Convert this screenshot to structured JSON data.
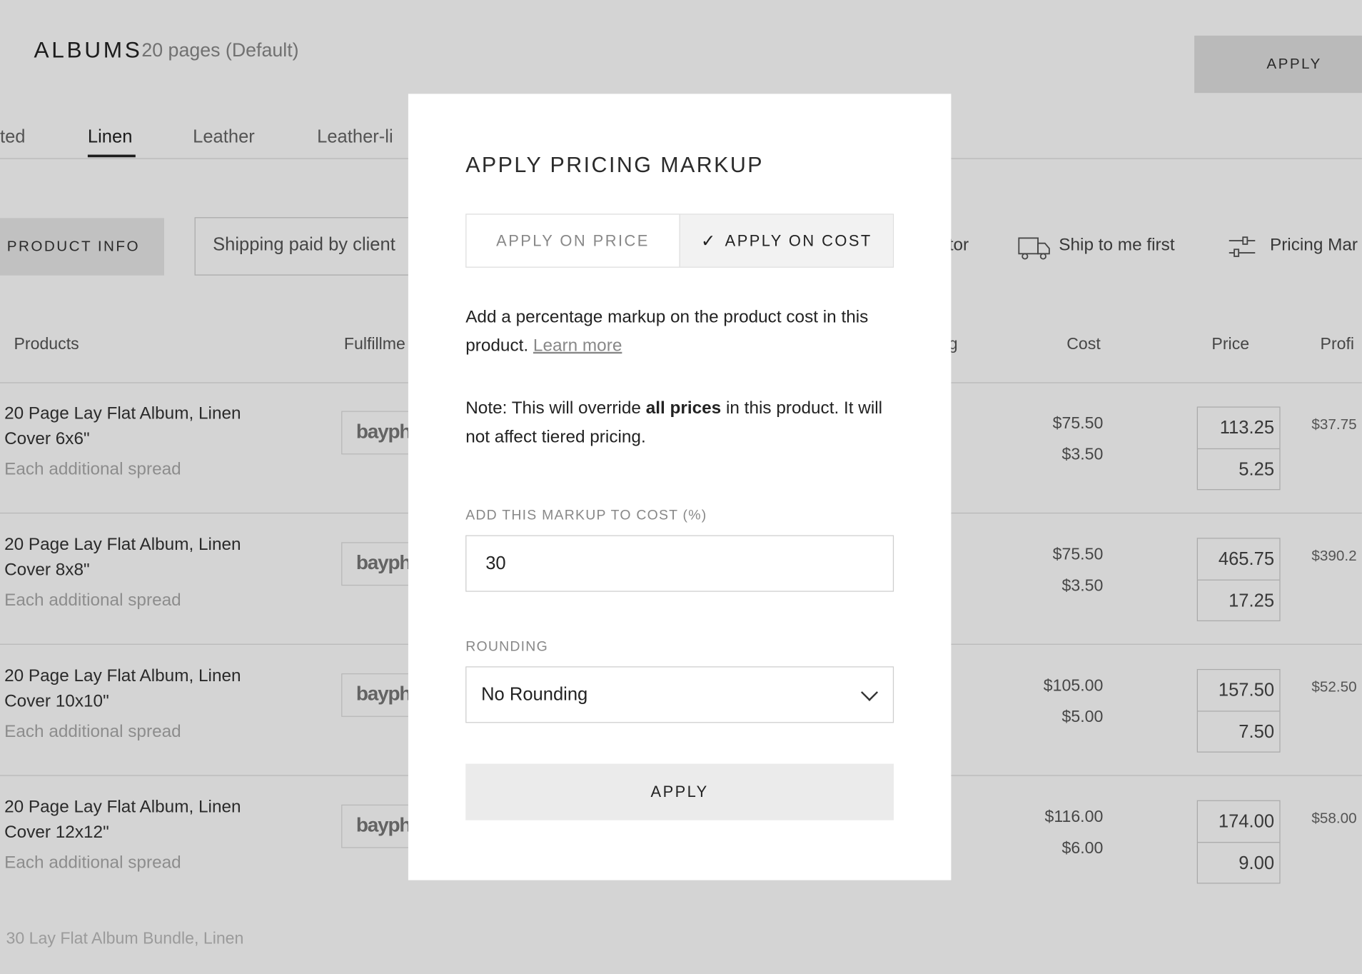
{
  "header": {
    "title": "ALBUMS",
    "subtitle": "20 pages (Default)",
    "apply_label": "APPLY"
  },
  "tabs": [
    {
      "label": "ted"
    },
    {
      "label": "Linen"
    },
    {
      "label": "Leather"
    },
    {
      "label": "Leather-li"
    }
  ],
  "toolbar": {
    "product_info": "PRODUCT INFO",
    "shipping": "Shipping paid by client",
    "calculator": "tor",
    "ship_first": "Ship to me first",
    "pricing": "Pricing Mar"
  },
  "columns": {
    "products": "Products",
    "fulfillment": "Fulfillme",
    "shipping": "g",
    "cost": "Cost",
    "price": "Price",
    "profit": "Profi"
  },
  "rows": [
    {
      "name": "20 Page Lay Flat Album, Linen Cover 6x6\"",
      "sub": "Each additional spread",
      "logo": "bayph",
      "cost1": "$75.50",
      "cost2": "$3.50",
      "price1": "113.25",
      "price2": "5.25",
      "profit": "$37.75"
    },
    {
      "name": "20 Page Lay Flat Album, Linen Cover 8x8\"",
      "sub": "Each additional spread",
      "logo": "bayph",
      "cost1": "$75.50",
      "cost2": "$3.50",
      "price1": "465.75",
      "price2": "17.25",
      "profit": "$390.2"
    },
    {
      "name": "20 Page Lay Flat Album, Linen Cover 10x10\"",
      "sub": "Each additional spread",
      "logo": "bayph",
      "cost1": "$105.00",
      "cost2": "$5.00",
      "price1": "157.50",
      "price2": "7.50",
      "profit": "$52.50"
    },
    {
      "name": "20 Page Lay Flat Album, Linen Cover 12x12\"",
      "sub": "Each additional spread",
      "logo": "bayph",
      "cost1": "$116.00",
      "cost2": "$6.00",
      "price1": "174.00",
      "price2": "9.00",
      "profit": "$58.00"
    }
  ],
  "footer_row": "30 Lay Flat Album Bundle, Linen",
  "modal": {
    "title": "APPLY PRICING MARKUP",
    "seg_price": "APPLY ON PRICE",
    "seg_cost": "APPLY ON COST",
    "check_icon": "✓",
    "desc_text": "Add a percentage markup on the product cost in this product.",
    "learn_more": "Learn more",
    "note_prefix": "Note: This will override",
    "note_bold": "all prices",
    "note_suffix": "in this product. It will not affect tiered pricing.",
    "markup_label": "ADD THIS MARKUP TO COST (%)",
    "markup_value": "30",
    "rounding_label": "ROUNDING",
    "rounding_value": "No Rounding",
    "apply_label": "APPLY"
  }
}
